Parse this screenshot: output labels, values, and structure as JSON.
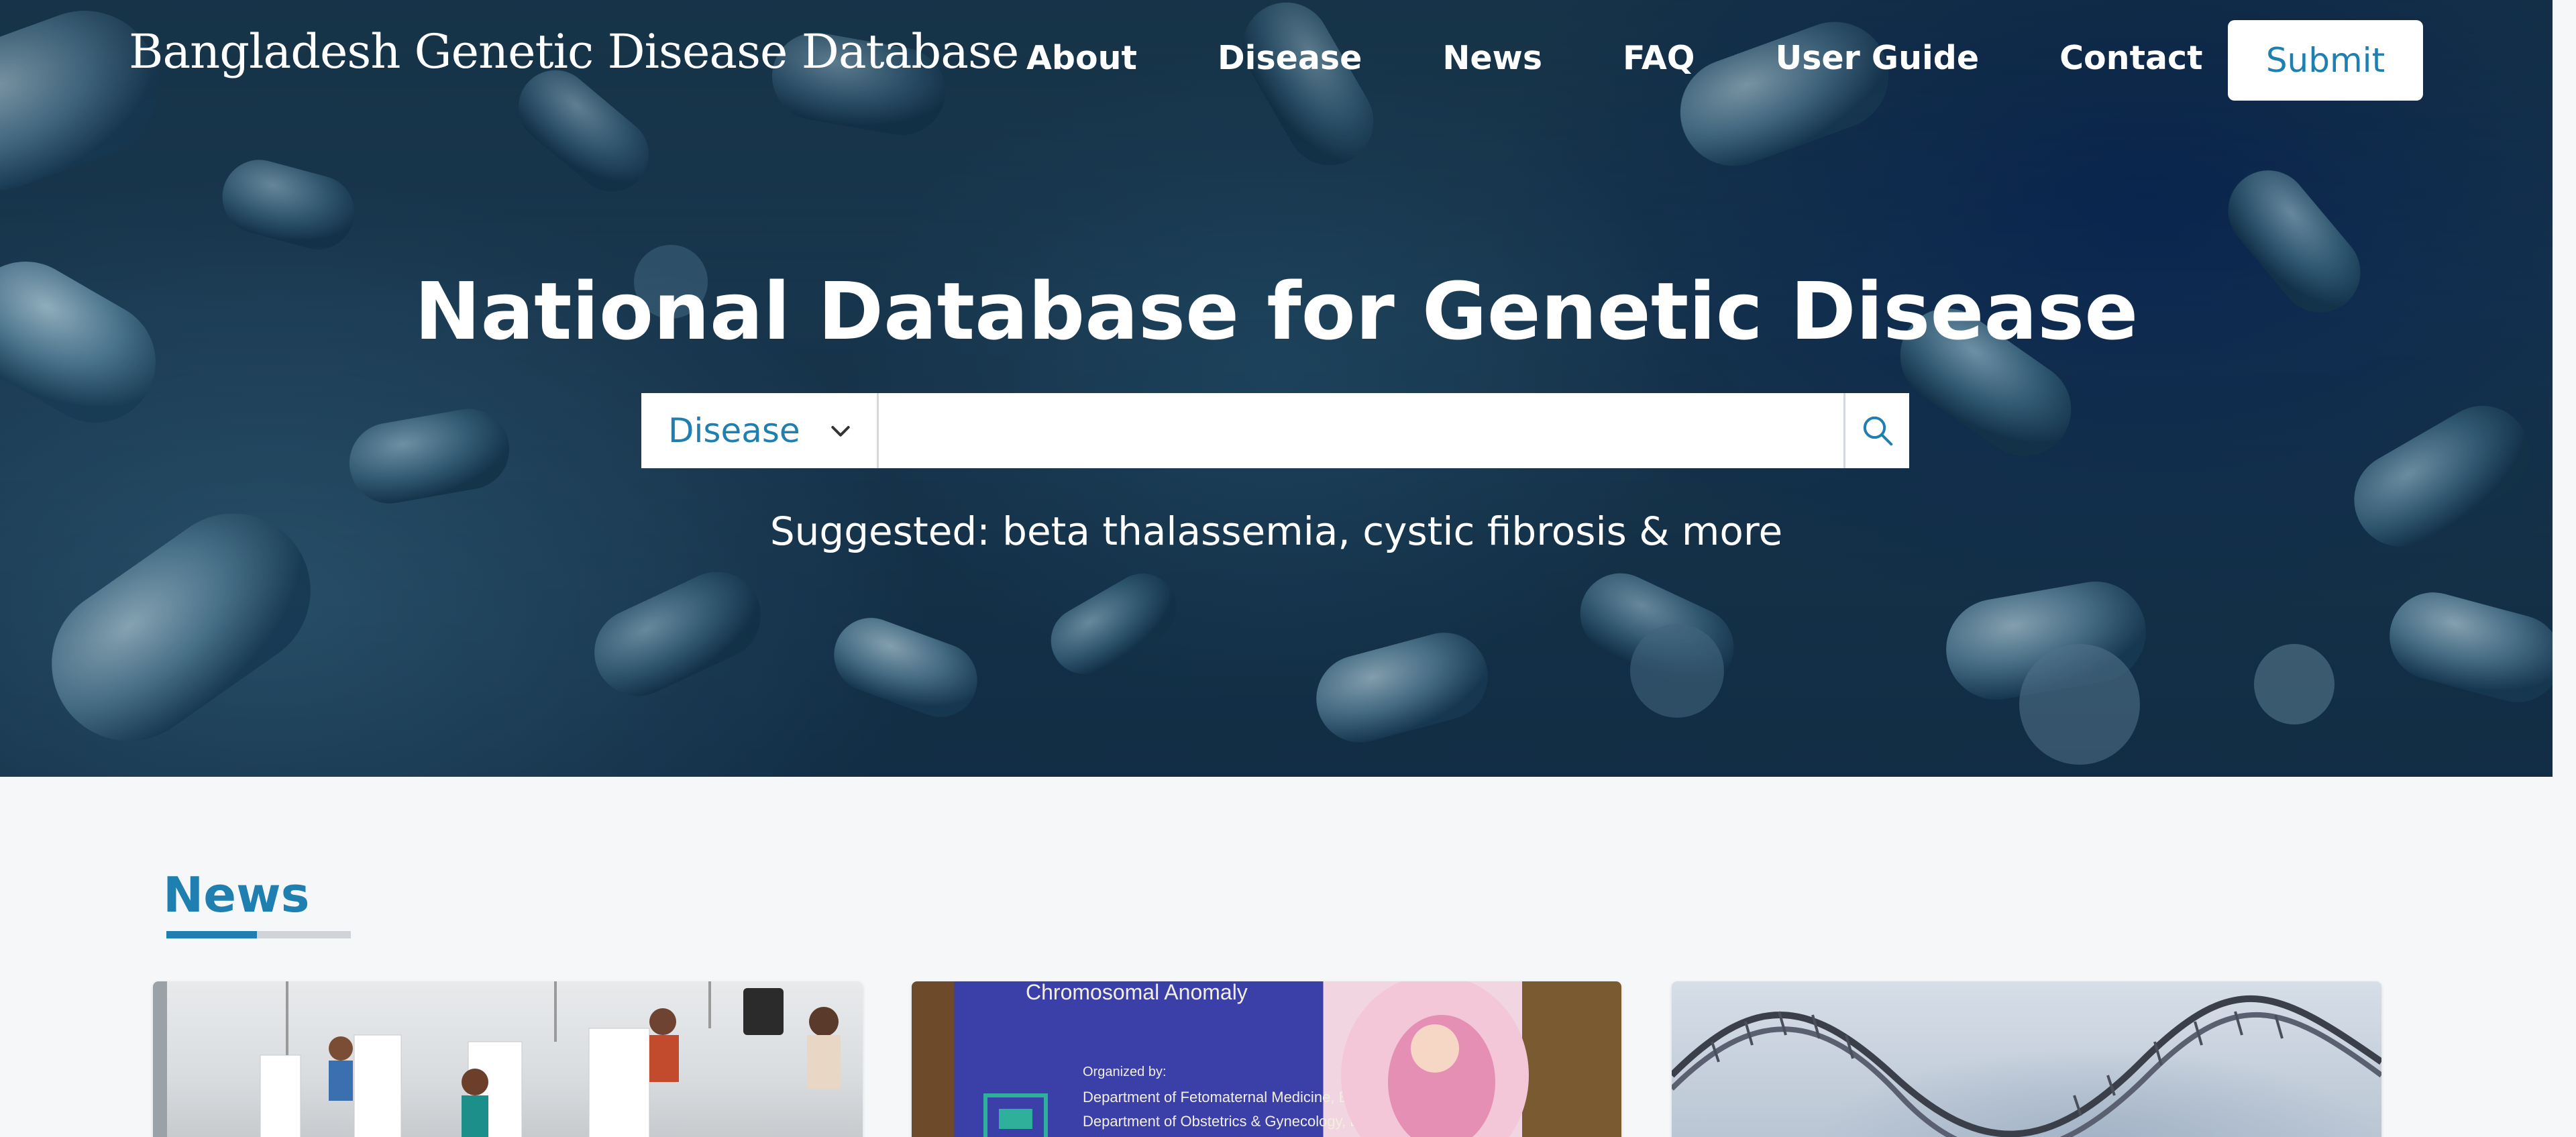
{
  "header": {
    "brand": "Bangladesh Genetic Disease Database",
    "nav": [
      "About",
      "Disease",
      "News",
      "FAQ",
      "User Guide",
      "Contact"
    ],
    "submit_label": "Submit"
  },
  "hero": {
    "title": "National Database for Genetic Disease",
    "search": {
      "category": "Disease",
      "query": "",
      "placeholder": ""
    },
    "suggested": "Suggested: beta thalassemia, cystic fibrosis & more"
  },
  "news": {
    "heading": "News",
    "cards": [
      {
        "image": "hospital-ward-photo"
      },
      {
        "image": "conference-banner-photo",
        "banner_lines": [
          "Chromosomal Anomaly",
          "Organized by:",
          "Department of Fetomaternal Medicine, BSMMU",
          "Department of Obstetrics & Gynecology, BSMMU"
        ]
      },
      {
        "image": "dna-helix-photo"
      }
    ]
  },
  "colors": {
    "accent": "#1f7fb0",
    "page_bg": "#f5f7f9",
    "hero_bg": "#1a3a52"
  }
}
